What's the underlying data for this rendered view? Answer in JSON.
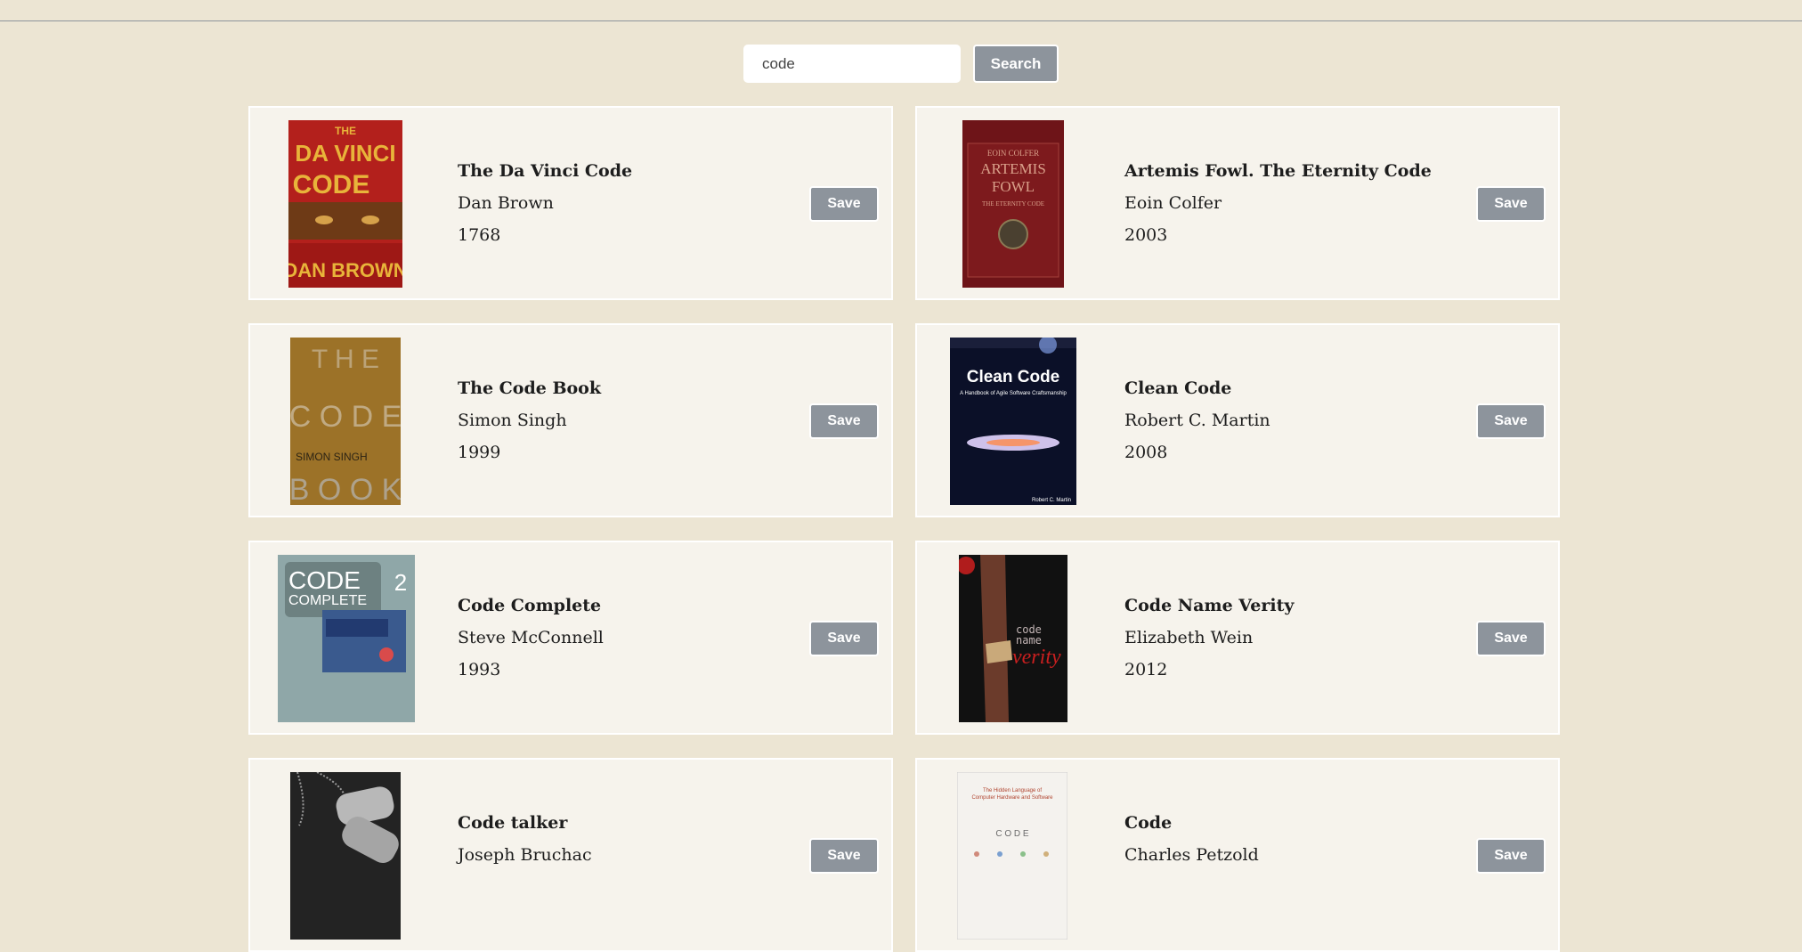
{
  "search": {
    "value": "code",
    "button_label": "Search"
  },
  "books": [
    {
      "title": "The Da Vinci Code",
      "author": "Dan Brown",
      "year": "1768",
      "save_label": "Save",
      "cover": {
        "line1": "THE",
        "line2": "DA VINCI",
        "line3": "CODE",
        "line4": "DAN BROWN"
      }
    },
    {
      "title": "Artemis Fowl. The Eternity Code",
      "author": "Eoin Colfer",
      "year": "2003",
      "save_label": "Save",
      "cover": {
        "line1": "EOIN COLFER",
        "line2": "ARTEMIS",
        "line3": "FOWL",
        "line4": "THE ETERNITY CODE"
      }
    },
    {
      "title": "The Code Book",
      "author": "Simon Singh",
      "year": "1999",
      "save_label": "Save",
      "cover": {
        "line1": "T H E",
        "line2": "C O D E",
        "line3": "SIMON SINGH",
        "line4": "B O O K"
      }
    },
    {
      "title": "Clean Code",
      "author": "Robert C. Martin",
      "year": "2008",
      "save_label": "Save",
      "cover": {
        "line1": "Clean Code",
        "line2": "A Handbook of Agile Software Craftsmanship",
        "line3": "Robert C. Martin",
        "line4": ""
      }
    },
    {
      "title": "Code Complete",
      "author": "Steve McConnell",
      "year": "1993",
      "save_label": "Save",
      "cover": {
        "line1": "CODE",
        "line2": "COMPLETE",
        "line3": "2",
        "line4": ""
      }
    },
    {
      "title": "Code Name Verity",
      "author": "Elizabeth Wein",
      "year": "2012",
      "save_label": "Save",
      "cover": {
        "line1": "code",
        "line2": "name",
        "line3": "verity",
        "line4": ""
      }
    },
    {
      "title": "Code talker",
      "author": "Joseph Bruchac",
      "year": "",
      "save_label": "Save",
      "cover": {
        "line1": "",
        "line2": "",
        "line3": "",
        "line4": ""
      }
    },
    {
      "title": "Code",
      "author": "Charles Petzold",
      "year": "",
      "save_label": "Save",
      "cover": {
        "line1": "The Hidden Language of",
        "line2": "Computer Hardware and Software",
        "line3": "C O D E",
        "line4": ""
      }
    }
  ]
}
